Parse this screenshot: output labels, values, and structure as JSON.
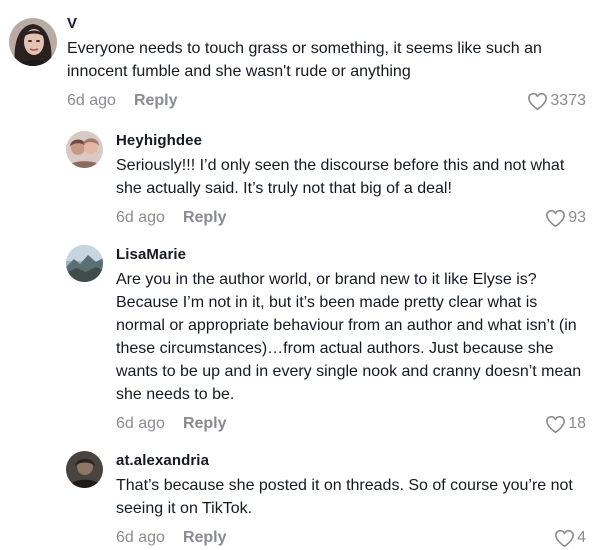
{
  "comments": [
    {
      "author": "V",
      "text": "Everyone needs to touch grass or something, it seems like such an innocent fumble and she wasn't rude or anything",
      "date": "6d ago",
      "reply_label": "Reply",
      "likes": "3373",
      "avatar_icon": "avatar-woman-dark-hair"
    },
    {
      "author": "Heyhighdee",
      "text": "Seriously!!! I’d only seen the discourse before this and not what she actually said. It’s truly not that big of a deal!",
      "date": "6d ago",
      "reply_label": "Reply",
      "likes": "93",
      "avatar_icon": "avatar-two-people"
    },
    {
      "author": "LisaMarie",
      "text": "Are you in the author world, or brand new to it like Elyse is? Because I’m not in it, but it’s been made pretty clear what is normal or appropriate behaviour from an author and what isn’t (in these circumstances)…from actual authors. Just because she wants to be up and in every single nook and cranny doesn’t mean she needs to be.",
      "date": "6d ago",
      "reply_label": "Reply",
      "likes": "18",
      "avatar_icon": "avatar-landscape"
    },
    {
      "author": "at.alexandria",
      "text": "That’s because she posted it on threads. So of course you’re not seeing it on TikTok.",
      "date": "6d ago",
      "reply_label": "Reply",
      "likes": "4",
      "avatar_icon": "avatar-person-dark"
    }
  ],
  "colors": {
    "text": "#161823",
    "muted": "#8a8b91"
  }
}
